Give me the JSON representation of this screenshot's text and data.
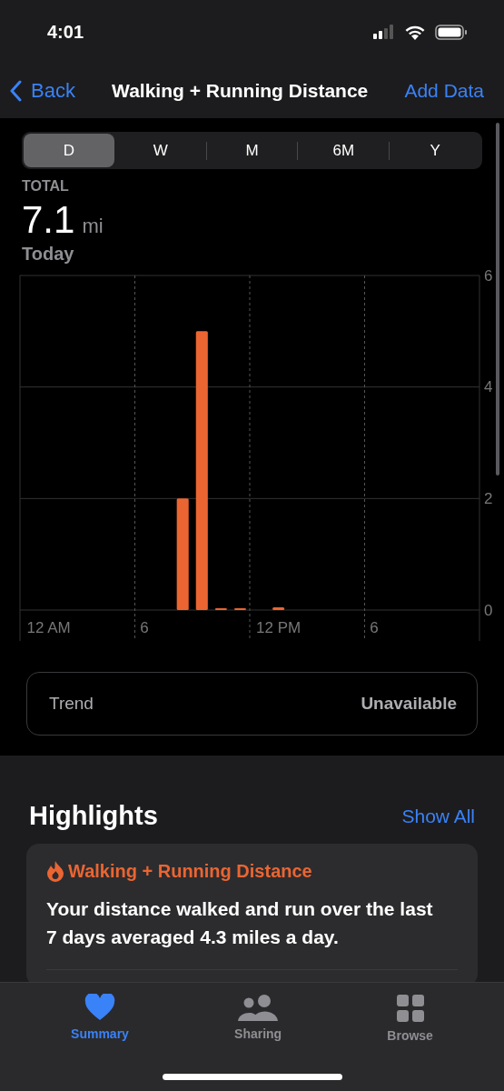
{
  "status_bar": {
    "time": "4:01"
  },
  "nav": {
    "back": "Back",
    "title": "Walking + Running Distance",
    "action": "Add Data"
  },
  "segments": [
    {
      "label": "D",
      "selected": true
    },
    {
      "label": "W",
      "selected": false
    },
    {
      "label": "M",
      "selected": false
    },
    {
      "label": "6M",
      "selected": false
    },
    {
      "label": "Y",
      "selected": false
    }
  ],
  "summary": {
    "label": "TOTAL",
    "value": "7.1",
    "unit": "mi",
    "date": "Today"
  },
  "chart": {
    "chart_data": {
      "type": "bar",
      "categories": [
        null,
        "12 AM",
        null,
        null,
        null,
        null,
        "6",
        null,
        null,
        null,
        null,
        null,
        null,
        "12 PM",
        null,
        null,
        null,
        null,
        "6",
        null,
        null,
        null,
        null,
        null
      ],
      "series": [
        {
          "color": "#eb6532",
          "values": [
            null,
            null,
            null,
            null,
            null,
            null,
            null,
            null,
            2.0,
            5.0,
            0.03,
            0.02,
            null,
            0.05,
            null,
            null,
            null,
            null,
            null,
            null,
            null,
            null,
            null,
            null
          ]
        }
      ],
      "ylim": [
        0,
        6
      ],
      "yticks": [
        0,
        2,
        4,
        6
      ]
    }
  },
  "trend": {
    "label": "Trend",
    "value": "Unavailable"
  },
  "highlights": {
    "title": "Highlights",
    "show_all": "Show All",
    "card": {
      "title": "Walking + Running Distance",
      "text": "Your distance walked and run over the last 7 days averaged 4.3 miles a day."
    }
  },
  "tab_bar": [
    {
      "kind": "heart",
      "label": "Summary",
      "selected": true
    },
    {
      "kind": "people",
      "label": "Sharing",
      "selected": false
    },
    {
      "kind": "grid",
      "label": "Browse",
      "selected": false
    }
  ]
}
